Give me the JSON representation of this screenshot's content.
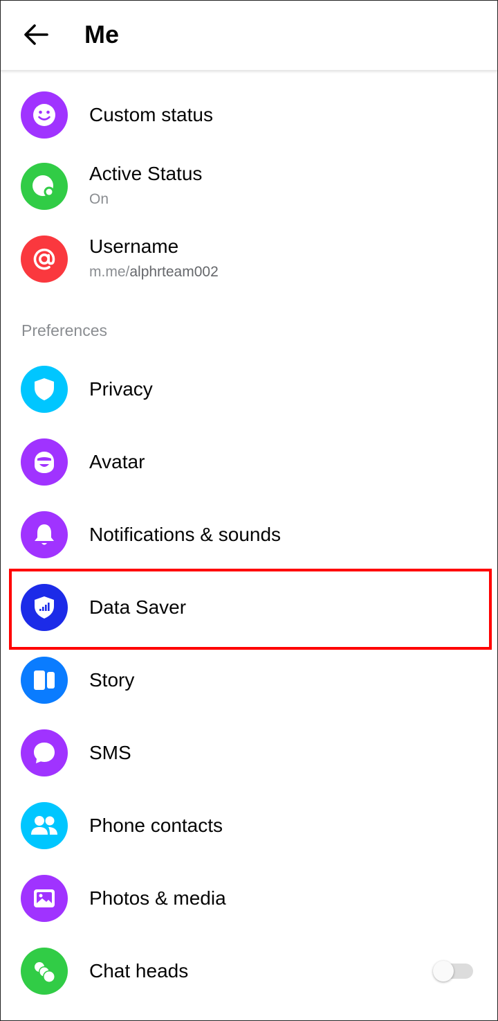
{
  "header": {
    "title": "Me",
    "back_icon": "arrow-left-icon"
  },
  "profile_items": [
    {
      "label": "Custom status",
      "icon": "smiley-icon",
      "color": "#A033FF"
    },
    {
      "label": "Active Status",
      "sub": "On",
      "icon": "active-status-icon",
      "color": "#31CC46"
    },
    {
      "label": "Username",
      "sub_prefix": "m.me/",
      "sub_value": "alphrteam002",
      "icon": "at-icon",
      "color": "#FA383E"
    }
  ],
  "preferences": {
    "header": "Preferences",
    "items": [
      {
        "label": "Privacy",
        "icon": "shield-icon",
        "color": "#00C6FF"
      },
      {
        "label": "Avatar",
        "icon": "avatar-icon",
        "color": "#A033FF"
      },
      {
        "label": "Notifications & sounds",
        "icon": "bell-icon",
        "color": "#A033FF"
      },
      {
        "label": "Data Saver",
        "icon": "data-saver-shield-icon",
        "color": "#1C2BE8"
      },
      {
        "label": "Story",
        "icon": "story-icon",
        "color": "#0A7CFF"
      },
      {
        "label": "SMS",
        "icon": "chat-bubble-icon",
        "color": "#A033FF"
      },
      {
        "label": "Phone contacts",
        "icon": "people-icon",
        "color": "#00C6FF"
      },
      {
        "label": "Photos & media",
        "icon": "image-icon",
        "color": "#A033FF"
      },
      {
        "label": "Chat heads",
        "icon": "chat-heads-icon",
        "color": "#31CC46",
        "toggle": "off"
      }
    ]
  },
  "highlight": {
    "target": "Data Saver",
    "color": "#FF0000"
  }
}
